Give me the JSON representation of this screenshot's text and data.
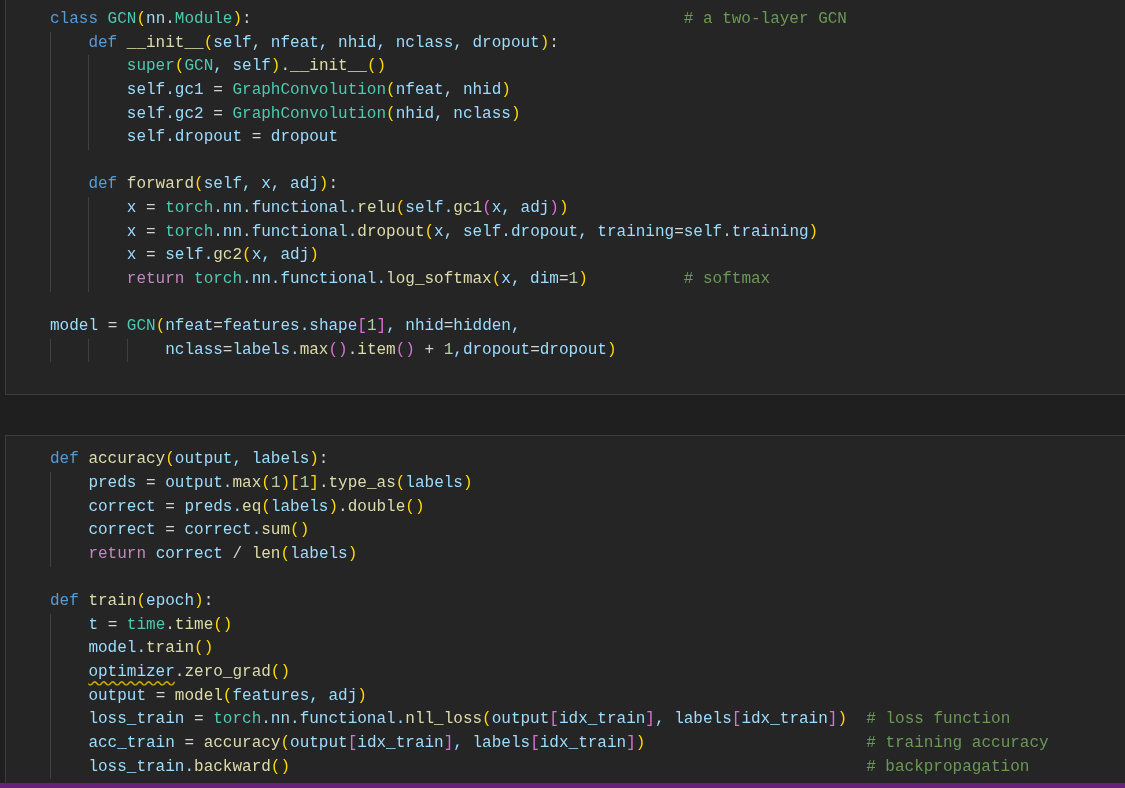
{
  "cells": [
    {
      "lines": [
        {
          "kind": "code",
          "tokens": [
            {
              "kind": "kw",
              "text": "class "
            },
            {
              "kind": "t",
              "text": "GCN"
            },
            {
              "kind": "b1",
              "text": "("
            },
            {
              "kind": "v",
              "text": "nn"
            },
            {
              "kind": "p",
              "text": "."
            },
            {
              "kind": "t",
              "text": "Module"
            },
            {
              "kind": "b1",
              "text": ")"
            },
            {
              "kind": "p",
              "text": ":                                             "
            },
            {
              "kind": "m",
              "text": "# a two-layer GCN"
            }
          ]
        },
        {
          "kind": "code",
          "tokens": [
            {
              "kind": "kw",
              "text": "    def "
            },
            {
              "kind": "f",
              "text": "__init__"
            },
            {
              "kind": "b1",
              "text": "("
            },
            {
              "kind": "v",
              "text": "self, nfeat, nhid, nclass, dropout"
            },
            {
              "kind": "b1",
              "text": ")"
            },
            {
              "kind": "p",
              "text": ":"
            }
          ]
        },
        {
          "kind": "code",
          "tokens": [
            {
              "kind": "t",
              "text": "        super"
            },
            {
              "kind": "b1",
              "text": "("
            },
            {
              "kind": "t",
              "text": "GCN"
            },
            {
              "kind": "v",
              "text": ", self"
            },
            {
              "kind": "b1",
              "text": ")"
            },
            {
              "kind": "p",
              "text": "."
            },
            {
              "kind": "f",
              "text": "__init__"
            },
            {
              "kind": "b1",
              "text": "()"
            }
          ]
        },
        {
          "kind": "code",
          "tokens": [
            {
              "kind": "v",
              "text": "        self.gc1"
            },
            {
              "kind": "p",
              "text": " = "
            },
            {
              "kind": "t",
              "text": "GraphConvolution"
            },
            {
              "kind": "b1",
              "text": "("
            },
            {
              "kind": "v",
              "text": "nfeat, nhid"
            },
            {
              "kind": "b1",
              "text": ")"
            }
          ]
        },
        {
          "kind": "code",
          "tokens": [
            {
              "kind": "v",
              "text": "        self.gc2"
            },
            {
              "kind": "p",
              "text": " = "
            },
            {
              "kind": "t",
              "text": "GraphConvolution"
            },
            {
              "kind": "b1",
              "text": "("
            },
            {
              "kind": "v",
              "text": "nhid, nclass"
            },
            {
              "kind": "b1",
              "text": ")"
            }
          ]
        },
        {
          "kind": "code",
          "tokens": [
            {
              "kind": "v",
              "text": "        self.dropout"
            },
            {
              "kind": "p",
              "text": " = "
            },
            {
              "kind": "v",
              "text": "dropout"
            }
          ]
        },
        {
          "kind": "blank"
        },
        {
          "kind": "code",
          "tokens": [
            {
              "kind": "kw",
              "text": "    def "
            },
            {
              "kind": "f",
              "text": "forward"
            },
            {
              "kind": "b1",
              "text": "("
            },
            {
              "kind": "v",
              "text": "self, x, adj"
            },
            {
              "kind": "b1",
              "text": ")"
            },
            {
              "kind": "p",
              "text": ":"
            }
          ]
        },
        {
          "kind": "code",
          "tokens": [
            {
              "kind": "v",
              "text": "        x"
            },
            {
              "kind": "p",
              "text": " = "
            },
            {
              "kind": "t",
              "text": "torch"
            },
            {
              "kind": "v",
              "text": ".nn.functional."
            },
            {
              "kind": "f",
              "text": "relu"
            },
            {
              "kind": "b1",
              "text": "("
            },
            {
              "kind": "v",
              "text": "self."
            },
            {
              "kind": "f",
              "text": "gc1"
            },
            {
              "kind": "b2",
              "text": "("
            },
            {
              "kind": "v",
              "text": "x, adj"
            },
            {
              "kind": "b2",
              "text": ")"
            },
            {
              "kind": "b1",
              "text": ")"
            }
          ]
        },
        {
          "kind": "code",
          "tokens": [
            {
              "kind": "v",
              "text": "        x"
            },
            {
              "kind": "p",
              "text": " = "
            },
            {
              "kind": "t",
              "text": "torch"
            },
            {
              "kind": "v",
              "text": ".nn.functional."
            },
            {
              "kind": "f",
              "text": "dropout"
            },
            {
              "kind": "b1",
              "text": "("
            },
            {
              "kind": "v",
              "text": "x, self.dropout, training"
            },
            {
              "kind": "p",
              "text": "="
            },
            {
              "kind": "v",
              "text": "self.training"
            },
            {
              "kind": "b1",
              "text": ")"
            }
          ]
        },
        {
          "kind": "code",
          "tokens": [
            {
              "kind": "v",
              "text": "        x"
            },
            {
              "kind": "p",
              "text": " = "
            },
            {
              "kind": "v",
              "text": "self."
            },
            {
              "kind": "f",
              "text": "gc2"
            },
            {
              "kind": "b1",
              "text": "("
            },
            {
              "kind": "v",
              "text": "x, adj"
            },
            {
              "kind": "b1",
              "text": ")"
            }
          ]
        },
        {
          "kind": "code",
          "tokens": [
            {
              "kind": "c",
              "text": "        return "
            },
            {
              "kind": "t",
              "text": "torch"
            },
            {
              "kind": "v",
              "text": ".nn.functional."
            },
            {
              "kind": "f",
              "text": "log_softmax"
            },
            {
              "kind": "b1",
              "text": "("
            },
            {
              "kind": "v",
              "text": "x, dim"
            },
            {
              "kind": "p",
              "text": "="
            },
            {
              "kind": "n",
              "text": "1"
            },
            {
              "kind": "b1",
              "text": ")          "
            },
            {
              "kind": "m",
              "text": "# softmax"
            }
          ]
        },
        {
          "kind": "blank"
        },
        {
          "kind": "code",
          "tokens": [
            {
              "kind": "v",
              "text": "model"
            },
            {
              "kind": "p",
              "text": " = "
            },
            {
              "kind": "t",
              "text": "GCN"
            },
            {
              "kind": "b1",
              "text": "("
            },
            {
              "kind": "v",
              "text": "nfeat"
            },
            {
              "kind": "p",
              "text": "="
            },
            {
              "kind": "v",
              "text": "features.shape"
            },
            {
              "kind": "b2",
              "text": "["
            },
            {
              "kind": "n",
              "text": "1"
            },
            {
              "kind": "b2",
              "text": "]"
            },
            {
              "kind": "v",
              "text": ", nhid"
            },
            {
              "kind": "p",
              "text": "="
            },
            {
              "kind": "v",
              "text": "hidden,"
            }
          ]
        },
        {
          "kind": "code",
          "tokens": [
            {
              "kind": "v",
              "text": "            nclass"
            },
            {
              "kind": "p",
              "text": "="
            },
            {
              "kind": "v",
              "text": "labels."
            },
            {
              "kind": "f",
              "text": "max"
            },
            {
              "kind": "b2",
              "text": "()"
            },
            {
              "kind": "p",
              "text": "."
            },
            {
              "kind": "f",
              "text": "item"
            },
            {
              "kind": "b2",
              "text": "()"
            },
            {
              "kind": "p",
              "text": " + "
            },
            {
              "kind": "n",
              "text": "1"
            },
            {
              "kind": "v",
              "text": ",dropout"
            },
            {
              "kind": "p",
              "text": "="
            },
            {
              "kind": "v",
              "text": "dropout"
            },
            {
              "kind": "b1",
              "text": ")"
            }
          ]
        }
      ]
    },
    {
      "lines": [
        {
          "kind": "code",
          "tokens": [
            {
              "kind": "kw",
              "text": "def "
            },
            {
              "kind": "f",
              "text": "accuracy"
            },
            {
              "kind": "b1",
              "text": "("
            },
            {
              "kind": "v",
              "text": "output, labels"
            },
            {
              "kind": "b1",
              "text": ")"
            },
            {
              "kind": "p",
              "text": ":"
            }
          ]
        },
        {
          "kind": "code",
          "tokens": [
            {
              "kind": "v",
              "text": "    preds"
            },
            {
              "kind": "p",
              "text": " = "
            },
            {
              "kind": "v",
              "text": "output."
            },
            {
              "kind": "f",
              "text": "max"
            },
            {
              "kind": "b1",
              "text": "("
            },
            {
              "kind": "n",
              "text": "1"
            },
            {
              "kind": "b1",
              "text": ")["
            },
            {
              "kind": "n",
              "text": "1"
            },
            {
              "kind": "b1",
              "text": "]"
            },
            {
              "kind": "p",
              "text": "."
            },
            {
              "kind": "f",
              "text": "type_as"
            },
            {
              "kind": "b1",
              "text": "("
            },
            {
              "kind": "v",
              "text": "labels"
            },
            {
              "kind": "b1",
              "text": ")"
            }
          ]
        },
        {
          "kind": "code",
          "tokens": [
            {
              "kind": "v",
              "text": "    correct"
            },
            {
              "kind": "p",
              "text": " = "
            },
            {
              "kind": "v",
              "text": "preds."
            },
            {
              "kind": "f",
              "text": "eq"
            },
            {
              "kind": "b1",
              "text": "("
            },
            {
              "kind": "v",
              "text": "labels"
            },
            {
              "kind": "b1",
              "text": ")"
            },
            {
              "kind": "p",
              "text": "."
            },
            {
              "kind": "f",
              "text": "double"
            },
            {
              "kind": "b1",
              "text": "()"
            }
          ]
        },
        {
          "kind": "code",
          "tokens": [
            {
              "kind": "v",
              "text": "    correct"
            },
            {
              "kind": "p",
              "text": " = "
            },
            {
              "kind": "v",
              "text": "correct."
            },
            {
              "kind": "f",
              "text": "sum"
            },
            {
              "kind": "b1",
              "text": "()"
            }
          ]
        },
        {
          "kind": "code",
          "tokens": [
            {
              "kind": "c",
              "text": "    return "
            },
            {
              "kind": "v",
              "text": "correct"
            },
            {
              "kind": "p",
              "text": " / "
            },
            {
              "kind": "f",
              "text": "len"
            },
            {
              "kind": "b1",
              "text": "("
            },
            {
              "kind": "v",
              "text": "labels"
            },
            {
              "kind": "b1",
              "text": ")"
            }
          ]
        },
        {
          "kind": "blank"
        },
        {
          "kind": "code",
          "tokens": [
            {
              "kind": "kw",
              "text": "def "
            },
            {
              "kind": "f",
              "text": "train"
            },
            {
              "kind": "b1",
              "text": "("
            },
            {
              "kind": "v",
              "text": "epoch"
            },
            {
              "kind": "b1",
              "text": ")"
            },
            {
              "kind": "p",
              "text": ":"
            }
          ]
        },
        {
          "kind": "code",
          "tokens": [
            {
              "kind": "v",
              "text": "    t"
            },
            {
              "kind": "p",
              "text": " = "
            },
            {
              "kind": "t",
              "text": "time"
            },
            {
              "kind": "p",
              "text": "."
            },
            {
              "kind": "f",
              "text": "time"
            },
            {
              "kind": "b1",
              "text": "()"
            }
          ]
        },
        {
          "kind": "code",
          "tokens": [
            {
              "kind": "v",
              "text": "    model."
            },
            {
              "kind": "f",
              "text": "train"
            },
            {
              "kind": "b1",
              "text": "()"
            }
          ]
        },
        {
          "kind": "code",
          "tokens": [
            {
              "kind": "v",
              "text": "    optimizer",
              "warning": true
            },
            {
              "kind": "p",
              "text": "."
            },
            {
              "kind": "f",
              "text": "zero_grad"
            },
            {
              "kind": "b1",
              "text": "()"
            }
          ]
        },
        {
          "kind": "code",
          "tokens": [
            {
              "kind": "v",
              "text": "    output"
            },
            {
              "kind": "p",
              "text": " = "
            },
            {
              "kind": "f",
              "text": "model"
            },
            {
              "kind": "b1",
              "text": "("
            },
            {
              "kind": "v",
              "text": "features, adj"
            },
            {
              "kind": "b1",
              "text": ")"
            }
          ]
        },
        {
          "kind": "code",
          "tokens": [
            {
              "kind": "v",
              "text": "    loss_train"
            },
            {
              "kind": "p",
              "text": " = "
            },
            {
              "kind": "t",
              "text": "torch"
            },
            {
              "kind": "v",
              "text": ".nn.functional."
            },
            {
              "kind": "f",
              "text": "nll_loss"
            },
            {
              "kind": "b1",
              "text": "("
            },
            {
              "kind": "v",
              "text": "output"
            },
            {
              "kind": "b2",
              "text": "["
            },
            {
              "kind": "v",
              "text": "idx_train"
            },
            {
              "kind": "b2",
              "text": "]"
            },
            {
              "kind": "v",
              "text": ", labels"
            },
            {
              "kind": "b2",
              "text": "["
            },
            {
              "kind": "v",
              "text": "idx_train"
            },
            {
              "kind": "b2",
              "text": "]"
            },
            {
              "kind": "b1",
              "text": ")  "
            },
            {
              "kind": "m",
              "text": "# loss function"
            }
          ]
        },
        {
          "kind": "code",
          "tokens": [
            {
              "kind": "v",
              "text": "    acc_train"
            },
            {
              "kind": "p",
              "text": " = "
            },
            {
              "kind": "f",
              "text": "accuracy"
            },
            {
              "kind": "b1",
              "text": "("
            },
            {
              "kind": "v",
              "text": "output"
            },
            {
              "kind": "b2",
              "text": "["
            },
            {
              "kind": "v",
              "text": "idx_train"
            },
            {
              "kind": "b2",
              "text": "]"
            },
            {
              "kind": "v",
              "text": ", labels"
            },
            {
              "kind": "b2",
              "text": "["
            },
            {
              "kind": "v",
              "text": "idx_train"
            },
            {
              "kind": "b2",
              "text": "]"
            },
            {
              "kind": "b1",
              "text": ")                       "
            },
            {
              "kind": "m",
              "text": "# training accuracy"
            }
          ]
        },
        {
          "kind": "code",
          "tokens": [
            {
              "kind": "v",
              "text": "    loss_train."
            },
            {
              "kind": "f",
              "text": "backward"
            },
            {
              "kind": "b1",
              "text": "()                                                            "
            },
            {
              "kind": "m",
              "text": "# backpropagation"
            }
          ]
        }
      ]
    }
  ]
}
